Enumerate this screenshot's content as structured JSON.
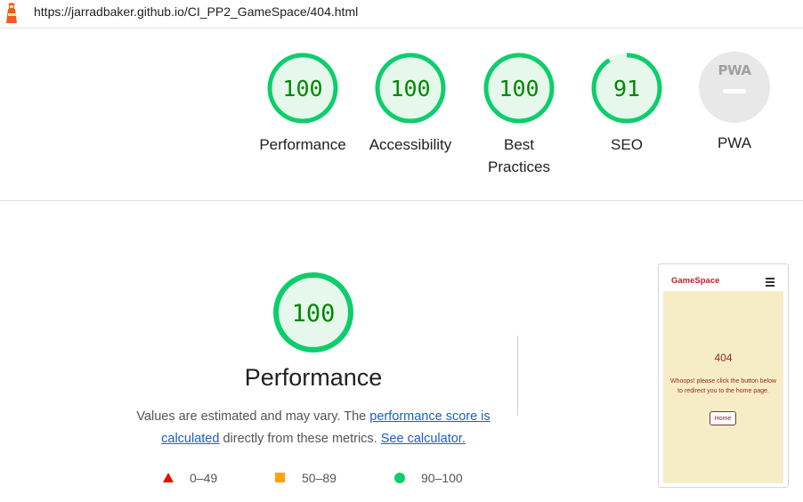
{
  "url": "https://jarradbaker.github.io/CI_PP2_GameSpace/404.html",
  "colors": {
    "pass": "#0cce6b",
    "pass_text": "#008800",
    "pass_fill": "#e6f8ec",
    "average": "#ffa400",
    "fail": "#eb0f00",
    "na": "#e8e8e8",
    "link": "#1a5fc8"
  },
  "gauges": [
    {
      "score": 100,
      "label": "Performance"
    },
    {
      "score": 100,
      "label": "Accessibility"
    },
    {
      "score": 100,
      "label": "Best Practices",
      "label_line1": "Best",
      "label_line2": "Practices"
    },
    {
      "score": 91,
      "label": "SEO"
    }
  ],
  "pwa": {
    "badge_text": "PWA",
    "label": "PWA"
  },
  "performance": {
    "score": 100,
    "title": "Performance",
    "desc_prefix": "Values are estimated and may vary. The ",
    "desc_link1": "performance score is calculated",
    "desc_middle": " directly from these metrics. ",
    "desc_link2": "See calculator."
  },
  "legend": [
    {
      "shape": "triangle",
      "range": "0–49"
    },
    {
      "shape": "square",
      "range": "50–89"
    },
    {
      "shape": "circle",
      "range": "90–100"
    }
  ],
  "screenshot": {
    "brand": "GameSpace",
    "heading": "404",
    "message": "Whoops! please click the button below to redirect you to the home page.",
    "button": "Home",
    "menu_icon": "hamburger-icon"
  }
}
